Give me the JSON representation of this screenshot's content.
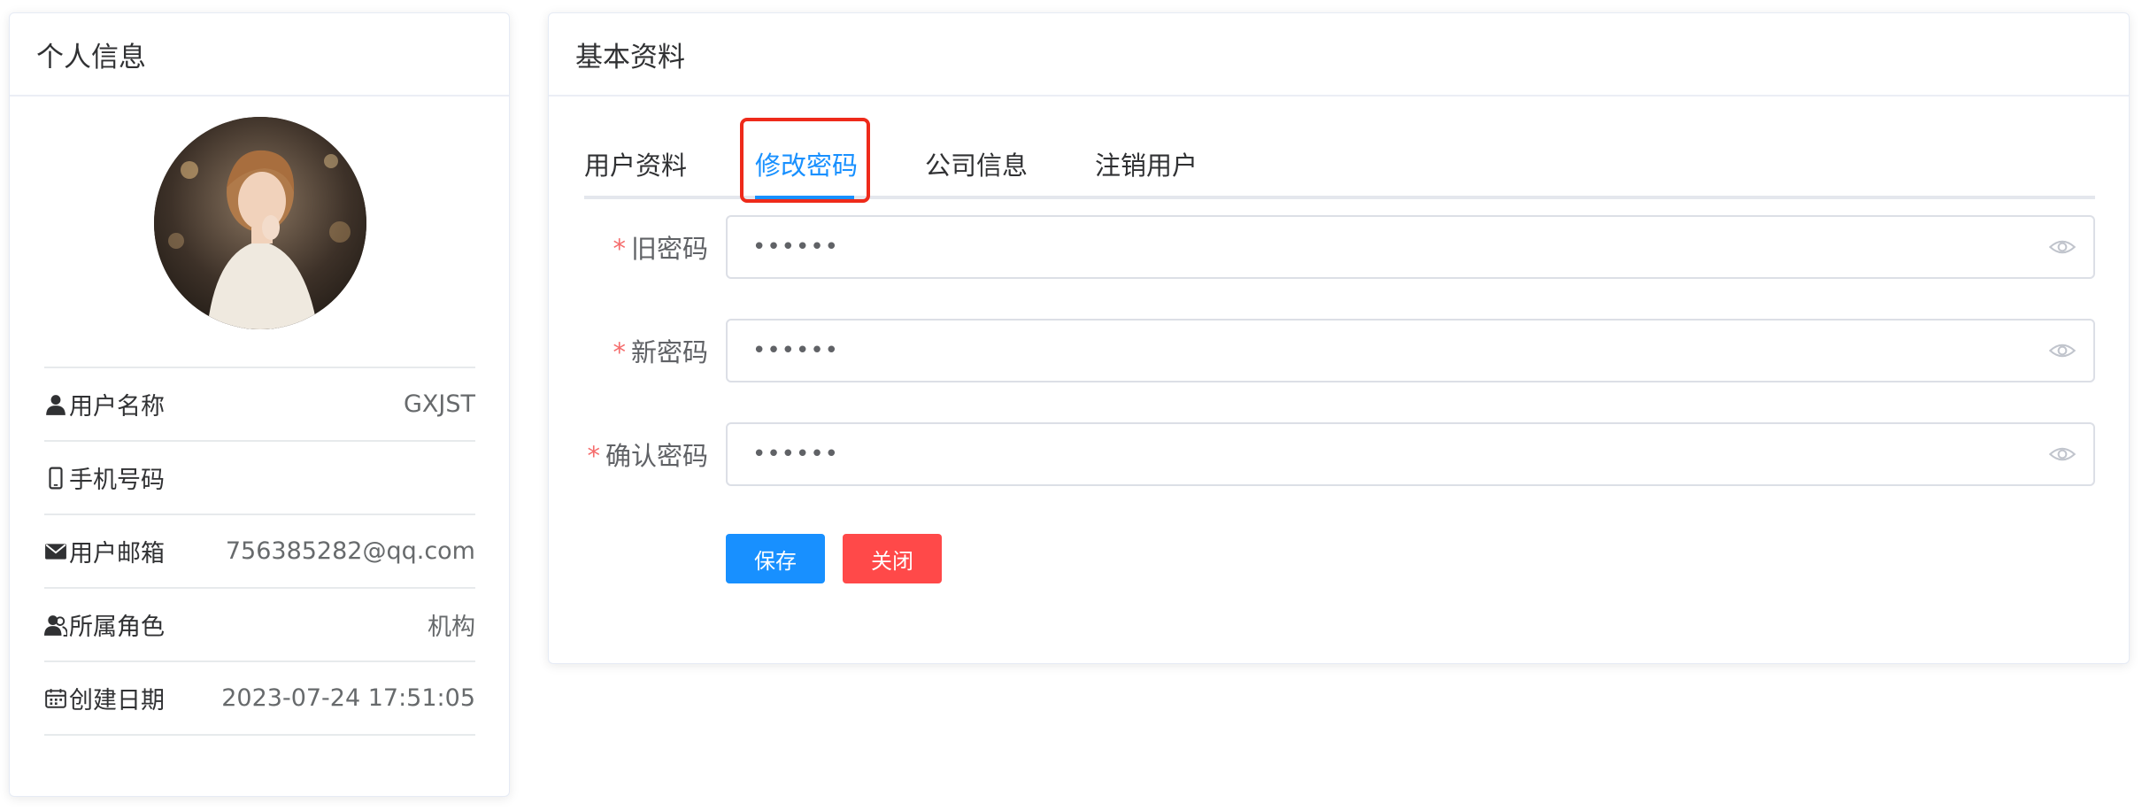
{
  "left_card": {
    "title": "个人信息",
    "items": [
      {
        "label": "用户名称",
        "value": "GXJST",
        "icon": "user-icon"
      },
      {
        "label": "手机号码",
        "value": "",
        "icon": "phone-icon"
      },
      {
        "label": "用户邮箱",
        "value": "756385282@qq.com",
        "icon": "email-icon"
      },
      {
        "label": "所属角色",
        "value": "机构",
        "icon": "role-icon"
      },
      {
        "label": "创建日期",
        "value": "2023-07-24 17:51:05",
        "icon": "calendar-icon"
      }
    ]
  },
  "right_card": {
    "title": "基本资料",
    "tabs": [
      "用户资料",
      "修改密码",
      "公司信息",
      "注销用户"
    ],
    "active_tab": "修改密码",
    "fields": [
      {
        "label": "旧密码",
        "required_mark": "*",
        "value": "••••••"
      },
      {
        "label": "新密码",
        "required_mark": "*",
        "value": "••••••"
      },
      {
        "label": "确认密码",
        "required_mark": "*",
        "value": "••••••"
      }
    ],
    "buttons": {
      "save": "保存",
      "close": "关闭"
    }
  },
  "colors": {
    "primary": "#1890ff",
    "danger": "#ff4949",
    "highlight": "#ee2a1a",
    "required": "#f56c6c"
  }
}
